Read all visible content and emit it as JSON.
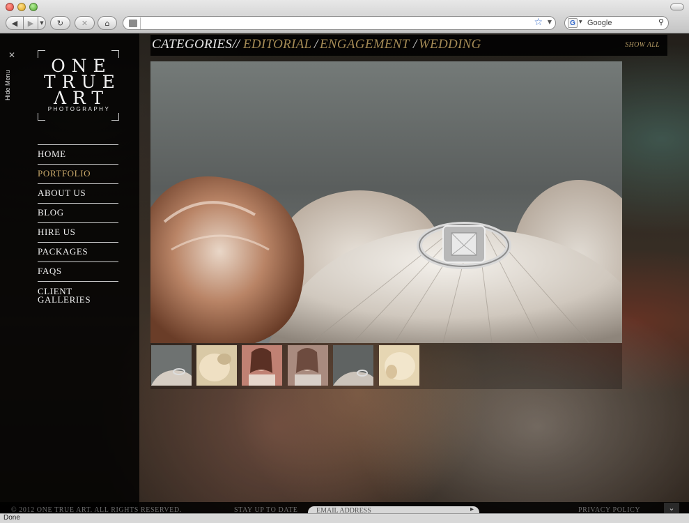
{
  "browser": {
    "search_placeholder": "Google",
    "status": "Done",
    "icons": [
      "back-icon",
      "forward-icon",
      "reload-icon",
      "stop-icon",
      "home-icon",
      "bookmark-star-icon",
      "search-icon"
    ]
  },
  "sidebar": {
    "hide_menu": "Hide Menu",
    "logo": {
      "line1": "ONE",
      "line2": "TRUE",
      "line3": "ΛRT",
      "sub": "PHOTOGRAPHY"
    },
    "nav": [
      {
        "label": "HOME",
        "active": false
      },
      {
        "label": "PORTFOLIO",
        "active": true
      },
      {
        "label": "ABOUT US",
        "active": false
      },
      {
        "label": "BLOG",
        "active": false
      },
      {
        "label": "HIRE US",
        "active": false
      },
      {
        "label": "PACKAGES",
        "active": false
      },
      {
        "label": "FAQS",
        "active": false
      },
      {
        "label": "CLIENT",
        "label2": "GALLERIES",
        "active": false
      }
    ]
  },
  "categories": {
    "label": "CATEGORIES//",
    "items": [
      "EDITORIAL",
      "ENGAGEMENT",
      "WEDDING"
    ],
    "separator": "/",
    "show_all": "SHOW ALL"
  },
  "footer": {
    "copyright": "© 2012 ONE TRUE ART. ALL RIGHTS RESERVED.",
    "stay_up": "STAY UP TO DATE",
    "email_placeholder": "EMAIL ADDRESS",
    "privacy": "PRIVACY POLICY"
  },
  "colors": {
    "accent": "#c9a96b",
    "category": "#a48a55",
    "sidebar_bg": "#000000"
  }
}
